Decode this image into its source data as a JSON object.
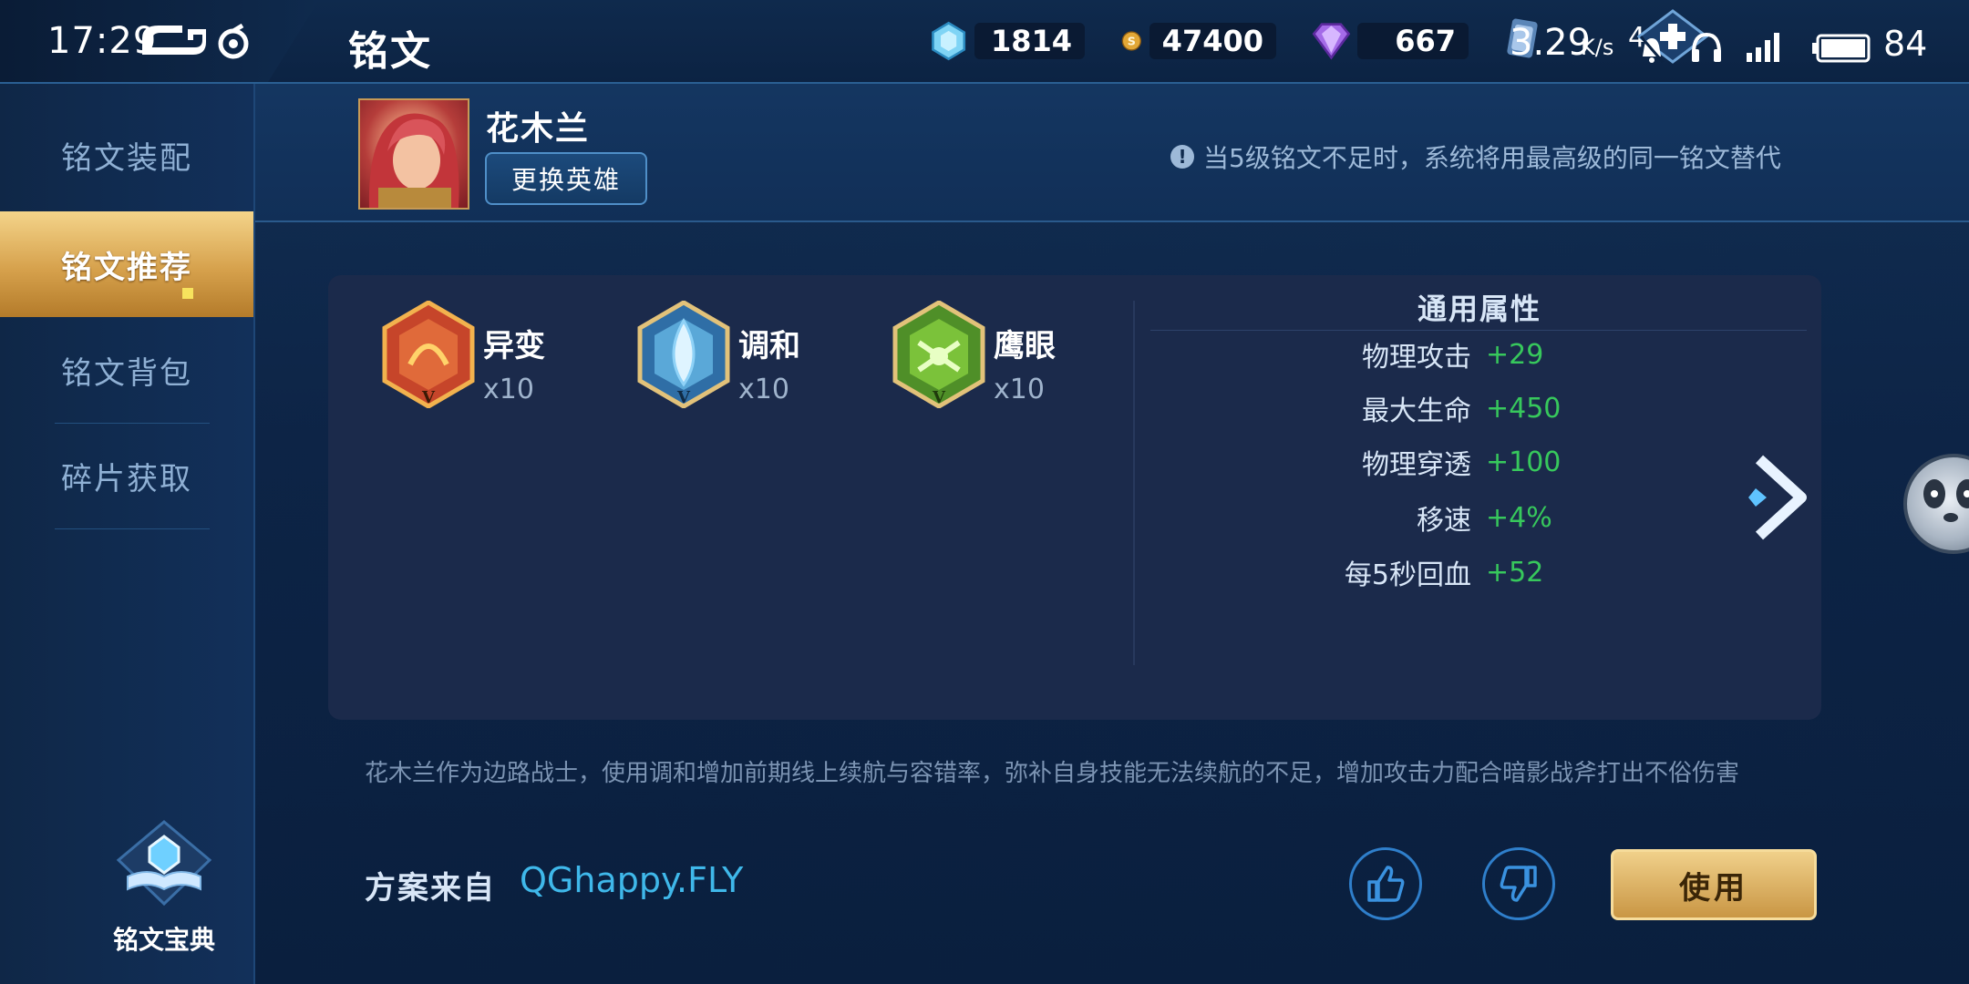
{
  "status_bar": {
    "time": "17:29",
    "net_speed": "3.29",
    "net_unit": "K/s",
    "signal_label": "4",
    "battery": "84"
  },
  "header": {
    "title": "铭文"
  },
  "currencies": [
    {
      "icon": "gem-crystal-icon",
      "value": "1814"
    },
    {
      "icon": "gold-coin-icon",
      "value": "47400"
    },
    {
      "icon": "diamond-icon",
      "value": "667"
    }
  ],
  "sidebar": {
    "items": [
      {
        "label": "铭文装配",
        "active": false
      },
      {
        "label": "铭文推荐",
        "active": true
      },
      {
        "label": "铭文背包",
        "active": false
      },
      {
        "label": "碎片获取",
        "active": false
      }
    ],
    "codex_label": "铭文宝典"
  },
  "hero": {
    "name": "花木兰",
    "change_button": "更换英雄"
  },
  "notice": "当5级铭文不足时，系统将用最高级的同一铭文替代",
  "runes": [
    {
      "name": "异变",
      "count": "x10",
      "color": "#c6452a",
      "level": "V"
    },
    {
      "name": "调和",
      "count": "x10",
      "color": "#5aa8d8",
      "level": "V"
    },
    {
      "name": "鹰眼",
      "count": "x10",
      "color": "#7bc23a",
      "level": "V"
    }
  ],
  "attributes": {
    "title": "通用属性",
    "rows": [
      {
        "key": "物理攻击",
        "value": "+29"
      },
      {
        "key": "最大生命",
        "value": "+450"
      },
      {
        "key": "物理穿透",
        "value": "+100"
      },
      {
        "key": "移速",
        "value": "+4%"
      },
      {
        "key": "每5秒回血",
        "value": "+52"
      }
    ]
  },
  "description": "花木兰作为边路战士，使用调和增加前期线上续航与容错率，弥补自身技能无法续航的不足，增加攻击力配合暗影战斧打出不俗伤害",
  "source": {
    "label": "方案来自",
    "author": "QGhappy.FLY"
  },
  "actions": {
    "use": "使用"
  },
  "colors": {
    "accent_gold": "#d6a14c",
    "positive_green": "#37c85c",
    "author_blue": "#3fb8ea"
  }
}
